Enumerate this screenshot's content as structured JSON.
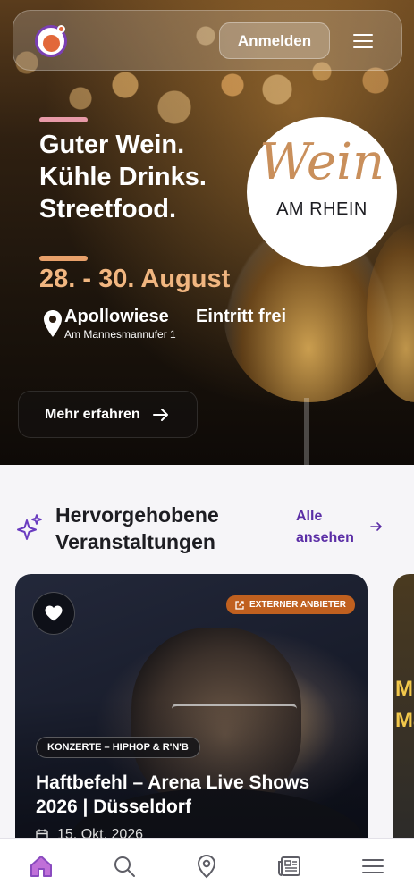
{
  "header": {
    "login_label": "Anmelden",
    "logo_icon": "basketball-logo-icon",
    "menu_icon": "hamburger-menu-icon"
  },
  "hero": {
    "headline": [
      "Guter Wein.",
      "Kühle Drinks.",
      "Streetfood."
    ],
    "badge_script": "Wein",
    "badge_sub": "AM RHEIN",
    "dates": "28. - 30. August",
    "location_name": "Apollowiese",
    "location_address": "Am Mannesmannufer 1",
    "entry": "Eintritt frei",
    "cta_label": "Mehr erfahren",
    "cta_icon": "arrow-right-icon"
  },
  "featured": {
    "title": "Hervorgehobene Veranstaltungen",
    "title_lines": [
      "Hervorgehobene",
      "Veranstaltungen"
    ],
    "all_label_lines": [
      "Alle",
      "ansehen"
    ],
    "icon": "sparkles-icon",
    "cards": [
      {
        "badge": "EXTERNER ANBIETER",
        "category": "KONZERTE – HIPHOP & R'N'B",
        "title": "Haftbefehl – Arena Live Shows 2026 | Düsseldorf",
        "date": "15. Okt. 2026",
        "favorite_icon": "heart-icon",
        "external_icon": "external-link-icon",
        "date_icon": "calendar-icon"
      }
    ],
    "next_card_text": [
      "Mo",
      "Ma"
    ]
  },
  "bottom_nav": {
    "items": [
      "home-icon",
      "search-icon",
      "map-pin-icon",
      "news-icon",
      "menu-icon"
    ],
    "active": "home-icon",
    "active_color": "#8a4bbf"
  },
  "colors": {
    "accent": "#5b2ea6",
    "date_text": "#f1b680",
    "external_badge": "#c0601f"
  }
}
